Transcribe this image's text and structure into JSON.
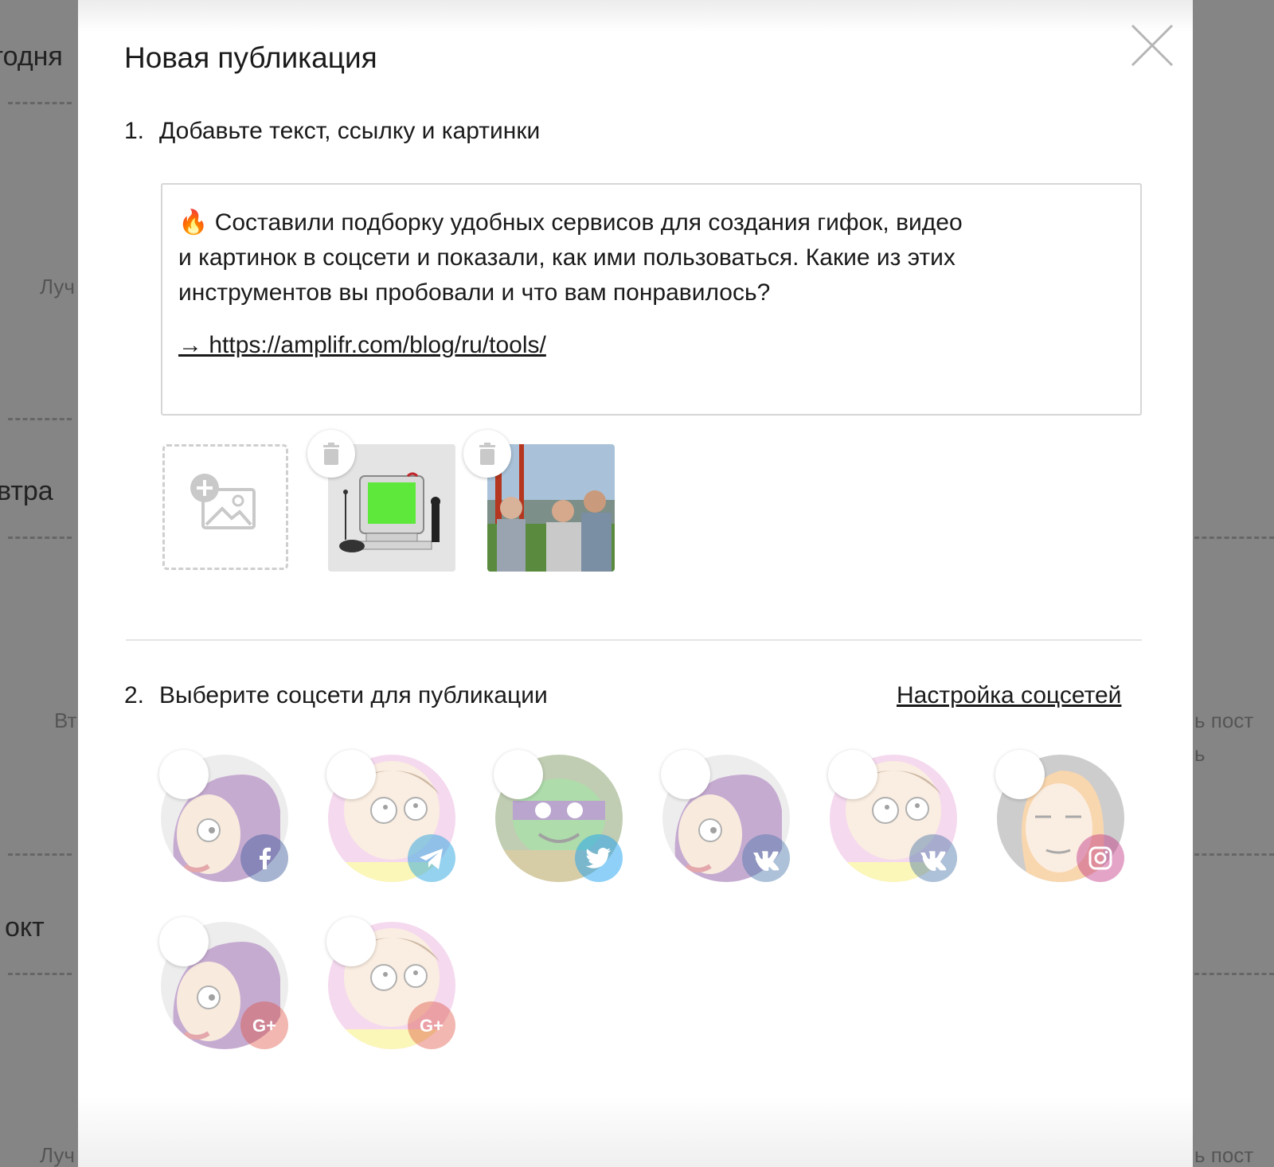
{
  "background": {
    "labels": [
      "годня",
      "Луч",
      "втра",
      "Вт",
      "окт",
      "Луч",
      "ь пост",
      "ь",
      "ь пост"
    ]
  },
  "modal": {
    "title": "Новая публикация",
    "step1": {
      "number": "1.",
      "label": "Добавьте текст, ссылку и картинки"
    },
    "post": {
      "lines": [
        "🔥 Составили подборку удобных сервисов для создания гифок, видео",
        "и картинок в соцсети и показали, как ими пользоваться. Какие из этих",
        "инструментов вы пробовали и что вам понравилось?"
      ],
      "link": "→ https://amplifr.com/blog/ru/tools/"
    },
    "step2": {
      "number": "2.",
      "label": "Выберите соцсети для публикации"
    },
    "settings_link": "Настройка соцсетей",
    "accounts": [
      {
        "avatar": "leela",
        "network": "facebook-icon",
        "color": "#3b5998"
      },
      {
        "avatar": "morty",
        "network": "telegram-icon",
        "color": "#2ca5e0"
      },
      {
        "avatar": "turtle",
        "network": "twitter-icon",
        "color": "#1da1f2"
      },
      {
        "avatar": "leela",
        "network": "vk-icon",
        "color": "#4a76a8"
      },
      {
        "avatar": "morty",
        "network": "vk-icon",
        "color": "#4a76a8"
      },
      {
        "avatar": "summer",
        "network": "instagram-icon",
        "color": "#c13584"
      },
      {
        "avatar": "leela",
        "network": "google-plus-icon",
        "color": "#dd4b39"
      },
      {
        "avatar": "morty",
        "network": "google-plus-icon",
        "color": "#dd4b39"
      }
    ]
  }
}
